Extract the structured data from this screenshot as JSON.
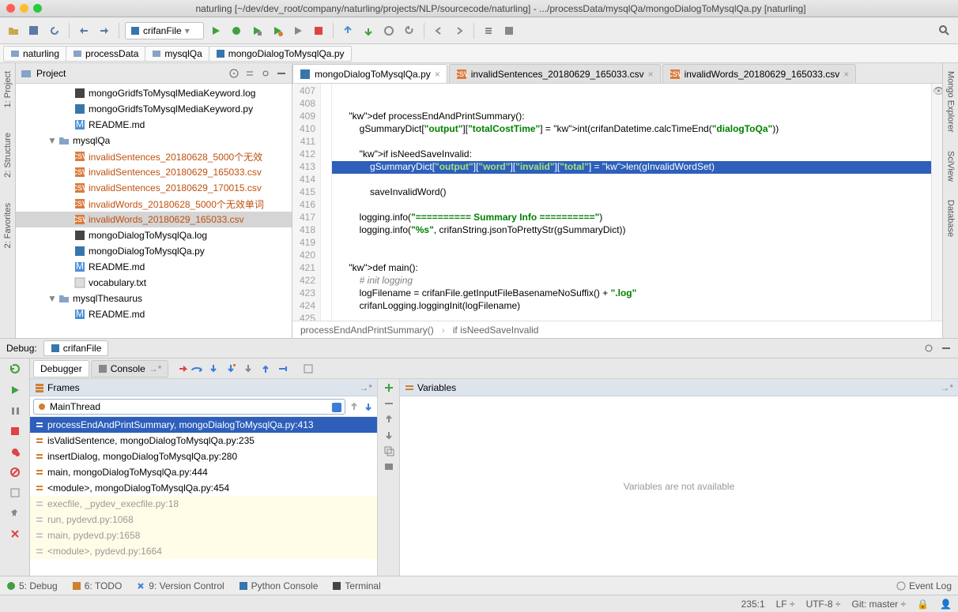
{
  "window": {
    "title": "naturling [~/dev/dev_root/company/naturling/projects/NLP/sourcecode/naturling] - .../processData/mysqlQa/mongoDialogToMysqlQa.py [naturling]"
  },
  "toolbar": {
    "run_config": "crifanFile"
  },
  "breadcrumbs": [
    "naturling",
    "processData",
    "mysqlQa",
    "mongoDialogToMysqlQa.py"
  ],
  "left_tabs": [
    "1: Project",
    "2: Structure",
    "2: Favorites"
  ],
  "right_tabs": [
    "Mongo Explorer",
    "SciView",
    "Database"
  ],
  "project": {
    "title": "Project",
    "items": [
      {
        "icon": "log",
        "label": "mongoGridfsToMysqlMediaKeyword.log",
        "cls": "",
        "depth": 2
      },
      {
        "icon": "py",
        "label": "mongoGridfsToMysqlMediaKeyword.py",
        "cls": "",
        "depth": 2
      },
      {
        "icon": "md",
        "label": "README.md",
        "cls": "",
        "depth": 2
      },
      {
        "icon": "folder",
        "label": "mysqlQa",
        "cls": "",
        "depth": 1,
        "expand": "▼"
      },
      {
        "icon": "csv",
        "label": "invalidSentences_20180628_5000个无效",
        "cls": "csv-txt",
        "depth": 2
      },
      {
        "icon": "csv",
        "label": "invalidSentences_20180629_165033.csv",
        "cls": "csv-txt",
        "depth": 2
      },
      {
        "icon": "csv",
        "label": "invalidSentences_20180629_170015.csv",
        "cls": "csv-txt",
        "depth": 2
      },
      {
        "icon": "csv",
        "label": "invalidWords_20180628_5000个无效单词",
        "cls": "csv-txt",
        "depth": 2
      },
      {
        "icon": "csv",
        "label": "invalidWords_20180629_165033.csv",
        "cls": "csv-txt",
        "depth": 2,
        "sel": true
      },
      {
        "icon": "log",
        "label": "mongoDialogToMysqlQa.log",
        "cls": "",
        "depth": 2
      },
      {
        "icon": "py",
        "label": "mongoDialogToMysqlQa.py",
        "cls": "",
        "depth": 2
      },
      {
        "icon": "md",
        "label": "README.md",
        "cls": "",
        "depth": 2
      },
      {
        "icon": "txt",
        "label": "vocabulary.txt",
        "cls": "",
        "depth": 2
      },
      {
        "icon": "folder",
        "label": "mysqlThesaurus",
        "cls": "",
        "depth": 1,
        "expand": "▼"
      },
      {
        "icon": "md",
        "label": "README.md",
        "cls": "",
        "depth": 2
      }
    ]
  },
  "editor": {
    "tabs": [
      {
        "icon": "py",
        "label": "mongoDialogToMysqlQa.py",
        "active": true
      },
      {
        "icon": "csv",
        "label": "invalidSentences_20180629_165033.csv",
        "active": false
      },
      {
        "icon": "csv",
        "label": "invalidWords_20180629_165033.csv",
        "active": false
      }
    ],
    "first_line": 407,
    "lines": [
      "",
      "",
      "    def processEndAndPrintSummary():",
      "        gSummaryDict[\"output\"][\"totalCostTime\"] = int(crifanDatetime.calcTimeEnd(\"dialogToQa\"))",
      "",
      "        if isNeedSaveInvalid:",
      "            gSummaryDict[\"output\"][\"word\"][\"invalid\"][\"total\"] = len(gInvalidWordSet)",
      "",
      "            saveInvalidWord()",
      "",
      "        logging.info(\"========== Summary Info ==========\")",
      "        logging.info(\"%s\", crifanString.jsonToPrettyStr(gSummaryDict))",
      "",
      "",
      "    def main():",
      "        # init logging",
      "        logFilename = crifanFile.getInputFileBasenameNoSuffix() + \".log\"",
      "        crifanLogging.loggingInit(logFilename)",
      ""
    ],
    "highlight_line_index": 6,
    "nav": [
      "processEndAndPrintSummary()",
      "if isNeedSaveInvalid"
    ]
  },
  "debug": {
    "label": "Debug:",
    "config": "crifanFile",
    "tabs": [
      "Debugger",
      "Console"
    ],
    "frames_label": "Frames",
    "vars_label": "Variables",
    "thread": "MainThread",
    "stack": [
      {
        "t": "processEndAndPrintSummary, mongoDialogToMysqlQa.py:413",
        "sel": true
      },
      {
        "t": "isValidSentence, mongoDialogToMysqlQa.py:235"
      },
      {
        "t": "insertDialog, mongoDialogToMysqlQa.py:280"
      },
      {
        "t": "main, mongoDialogToMysqlQa.py:444"
      },
      {
        "t": "<module>, mongoDialogToMysqlQa.py:454"
      },
      {
        "t": "execfile, _pydev_execfile.py:18",
        "dim": true
      },
      {
        "t": "run, pydevd.py:1068",
        "dim": true
      },
      {
        "t": "main, pydevd.py:1658",
        "dim": true
      },
      {
        "t": "<module>, pydevd.py:1664",
        "dim": true
      }
    ],
    "vars_msg": "Variables are not available"
  },
  "bottom": {
    "items": [
      "5: Debug",
      "6: TODO",
      "9: Version Control",
      "Python Console",
      "Terminal"
    ],
    "event_log": "Event Log"
  },
  "status": {
    "pos": "235:1",
    "le": "LF ÷",
    "enc": "UTF-8 ÷",
    "git": "Git: master ÷"
  }
}
